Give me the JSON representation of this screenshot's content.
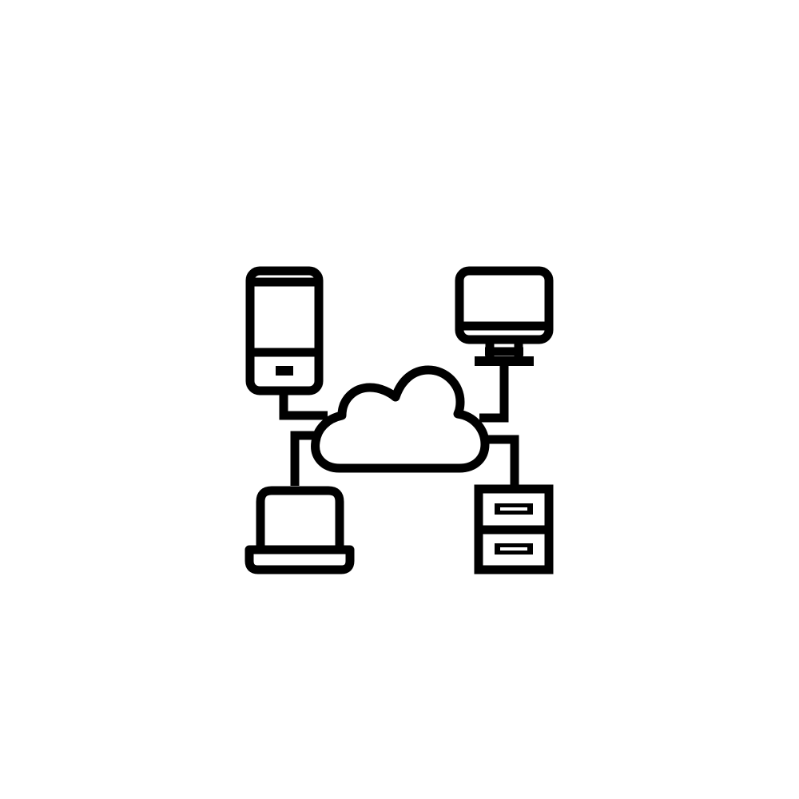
{
  "icon": {
    "name": "cloud-network-icon",
    "color": "#000000",
    "background": "#ffffff",
    "devices": [
      "smartphone-icon",
      "desktop-monitor-icon",
      "laptop-icon",
      "server-icon"
    ],
    "hub": "cloud-icon"
  }
}
